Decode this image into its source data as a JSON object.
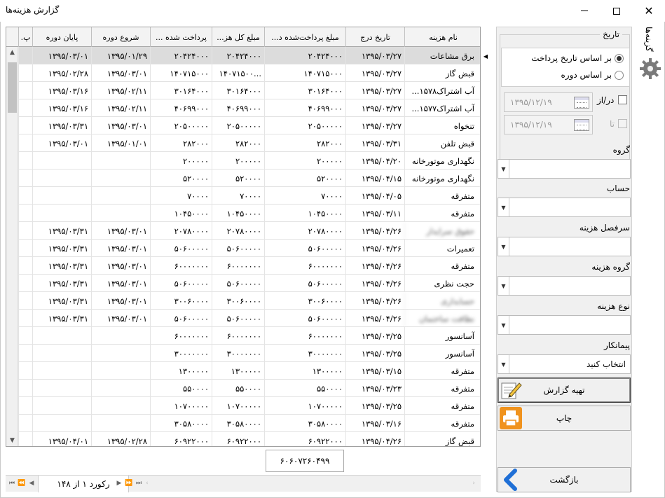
{
  "window": {
    "title": "گزارش هزینه‌ها",
    "min_label": "—",
    "close_label": "✕"
  },
  "grid": {
    "columns": [
      "پ.",
      "پایان دوره",
      "شروع دوره",
      "پرداخت شده ...",
      "مبلغ کل هز...",
      "مبلغ پرداخت‌شده د...",
      "تاریخ درج",
      "نام هزینه"
    ],
    "rows": [
      {
        "end": "۱۳۹۵/۰۳/۰۱",
        "start": "۱۳۹۵/۰۱/۲۹",
        "paid": "۲۰۴۲۴۰۰۰",
        "total": "۲۰۴۲۴۰۰۰",
        "paid_d": "۲۰۴۲۴۰۰۰",
        "date": "۱۳۹۵/۰۳/۲۷",
        "name": "برق مشاعات"
      },
      {
        "end": "۱۳۹۵/۰۲/۲۸",
        "start": "۱۳۹۵/۰۳/۰۱",
        "paid": "۱۴۰۷۱۵۰۰۰",
        "total": "...۱۴۰۷۱۵۰۰",
        "paid_d": "۱۴۰۷۱۵۰۰۰",
        "date": "۱۳۹۵/۰۳/۲۷",
        "name": "قبض گاز"
      },
      {
        "end": "۱۳۹۵/۰۳/۱۶",
        "start": "۱۳۹۵/۰۲/۱۱",
        "paid": "۳۰۱۶۴۰۰۰",
        "total": "۳۰۱۶۴۰۰۰",
        "paid_d": "۳۰۱۶۴۰۰۰",
        "date": "۱۳۹۵/۰۳/۲۷",
        "name": "آب اشتراک۱۵۷۸..."
      },
      {
        "end": "۱۳۹۵/۰۳/۱۶",
        "start": "۱۳۹۵/۰۲/۱۱",
        "paid": "۴۰۶۹۹۰۰۰",
        "total": "۴۰۶۹۹۰۰۰",
        "paid_d": "۴۰۶۹۹۰۰۰",
        "date": "۱۳۹۵/۰۳/۲۷",
        "name": "آب اشتراک۱۵۷۷..."
      },
      {
        "end": "۱۳۹۵/۰۳/۳۱",
        "start": "۱۳۹۵/۰۳/۰۱",
        "paid": "۲۰۵۰۰۰۰۰",
        "total": "۲۰۵۰۰۰۰۰",
        "paid_d": "۲۰۵۰۰۰۰۰",
        "date": "۱۳۹۵/۰۳/۲۷",
        "name": "تنخواه"
      },
      {
        "end": "۱۳۹۵/۰۳/۰۱",
        "start": "۱۳۹۵/۰۱/۰۱",
        "paid": "۲۸۲۰۰۰",
        "total": "۲۸۲۰۰۰",
        "paid_d": "۲۸۲۰۰۰",
        "date": "۱۳۹۵/۰۳/۳۱",
        "name": "قبض تلفن"
      },
      {
        "end": "",
        "start": "",
        "paid": "۲۰۰۰۰۰",
        "total": "۲۰۰۰۰۰",
        "paid_d": "۲۰۰۰۰۰",
        "date": "۱۳۹۵/۰۴/۲۰",
        "name": "نگهداری موتورخانه"
      },
      {
        "end": "",
        "start": "",
        "paid": "۵۲۰۰۰۰",
        "total": "۵۲۰۰۰۰",
        "paid_d": "۵۲۰۰۰۰",
        "date": "۱۳۹۵/۰۴/۱۵",
        "name": "نگهداری موتورخانه"
      },
      {
        "end": "",
        "start": "",
        "paid": "۷۰۰۰۰",
        "total": "۷۰۰۰۰",
        "paid_d": "۷۰۰۰۰",
        "date": "۱۳۹۵/۰۴/۰۵",
        "name": "متفرقه"
      },
      {
        "end": "",
        "start": "",
        "paid": "۱۰۴۵۰۰۰۰",
        "total": "۱۰۴۵۰۰۰۰",
        "paid_d": "۱۰۴۵۰۰۰۰",
        "date": "۱۳۹۵/۰۳/۱۱",
        "name": "متفرقه"
      },
      {
        "end": "۱۳۹۵/۰۳/۳۱",
        "start": "۱۳۹۵/۰۳/۰۱",
        "paid": "۲۰۷۸۰۰۰۰",
        "total": "۲۰۷۸۰۰۰۰",
        "paid_d": "۲۰۷۸۰۰۰۰",
        "date": "۱۳۹۵/۰۴/۲۶",
        "name": "حقوق سرایدار",
        "blur": true
      },
      {
        "end": "۱۳۹۵/۰۳/۳۱",
        "start": "۱۳۹۵/۰۳/۰۱",
        "paid": "۵۰۶۰۰۰۰۰",
        "total": "۵۰۶۰۰۰۰۰",
        "paid_d": "۵۰۶۰۰۰۰۰",
        "date": "۱۳۹۵/۰۴/۲۶",
        "name": "تعمیرات"
      },
      {
        "end": "۱۳۹۵/۰۳/۳۱",
        "start": "۱۳۹۵/۰۳/۰۱",
        "paid": "۶۰۰۰۰۰۰۰",
        "total": "۶۰۰۰۰۰۰۰",
        "paid_d": "۶۰۰۰۰۰۰۰",
        "date": "۱۳۹۵/۰۴/۲۶",
        "name": "متفرقه"
      },
      {
        "end": "۱۳۹۵/۰۳/۳۱",
        "start": "۱۳۹۵/۰۳/۰۱",
        "paid": "۵۰۶۰۰۰۰۰",
        "total": "۵۰۶۰۰۰۰۰",
        "paid_d": "۵۰۶۰۰۰۰۰",
        "date": "۱۳۹۵/۰۴/۲۶",
        "name": "حجت نظری"
      },
      {
        "end": "۱۳۹۵/۰۳/۳۱",
        "start": "۱۳۹۵/۰۳/۰۱",
        "paid": "۳۰۰۶۰۰۰۰",
        "total": "۳۰۰۶۰۰۰۰",
        "paid_d": "۳۰۰۶۰۰۰۰",
        "date": "۱۳۹۵/۰۴/۲۶",
        "name": "حسابداری",
        "blur": true
      },
      {
        "end": "۱۳۹۵/۰۳/۳۱",
        "start": "۱۳۹۵/۰۳/۰۱",
        "paid": "۵۰۶۰۰۰۰۰",
        "total": "۵۰۶۰۰۰۰۰",
        "paid_d": "۵۰۶۰۰۰۰۰",
        "date": "۱۳۹۵/۰۴/۲۶",
        "name": "نظافت ساختمان",
        "blur": true
      },
      {
        "end": "",
        "start": "",
        "paid": "۶۰۰۰۰۰۰۰",
        "total": "۶۰۰۰۰۰۰۰",
        "paid_d": "۶۰۰۰۰۰۰۰",
        "date": "۱۳۹۵/۰۳/۲۵",
        "name": "آسانسور"
      },
      {
        "end": "",
        "start": "",
        "paid": "۳۰۰۰۰۰۰۰",
        "total": "۳۰۰۰۰۰۰۰",
        "paid_d": "۳۰۰۰۰۰۰۰",
        "date": "۱۳۹۵/۰۳/۲۵",
        "name": "آسانسور"
      },
      {
        "end": "",
        "start": "",
        "paid": "۱۳۰۰۰۰۰",
        "total": "۱۳۰۰۰۰۰",
        "paid_d": "۱۳۰۰۰۰۰",
        "date": "۱۳۹۵/۰۳/۱۵",
        "name": "متفرقه"
      },
      {
        "end": "",
        "start": "",
        "paid": "۵۵۰۰۰۰",
        "total": "۵۵۰۰۰۰",
        "paid_d": "۵۵۰۰۰۰",
        "date": "۱۳۹۵/۰۳/۲۳",
        "name": "متفرقه"
      },
      {
        "end": "",
        "start": "",
        "paid": "۱۰۷۰۰۰۰۰",
        "total": "۱۰۷۰۰۰۰۰",
        "paid_d": "۱۰۷۰۰۰۰۰",
        "date": "۱۳۹۵/۰۳/۲۵",
        "name": "متفرقه"
      },
      {
        "end": "",
        "start": "",
        "paid": "۳۰۵۸۰۰۰۰",
        "total": "۳۰۵۸۰۰۰۰",
        "paid_d": "۳۰۵۸۰۰۰۰",
        "date": "۱۳۹۵/۰۳/۱۶",
        "name": "متفرقه"
      },
      {
        "end": "۱۳۹۵/۰۴/۰۱",
        "start": "۱۳۹۵/۰۲/۲۸",
        "paid": "۶۰۹۲۲۰۰۰",
        "total": "۶۰۹۲۲۰۰۰",
        "paid_d": "۶۰۹۲۲۰۰۰",
        "date": "۱۳۹۵/۰۴/۲۶",
        "name": "قبض گاز"
      }
    ],
    "total": "۶۰۶۰۷۲۶۰۴۹۹",
    "record_label": "رکورد ۱ از ۱۴۸"
  },
  "filters": {
    "date_legend": "تاریخ",
    "radio_payment": "بر اساس تاریخ پرداخت",
    "radio_period": "بر اساس دوره",
    "from_label": "در/از",
    "to_label": "تا",
    "from_date": "۱۳۹۵/۱۲/۱۹",
    "to_date": "۱۳۹۵/۱۲/۱۹",
    "group_label": "گروه",
    "account_label": "حساب",
    "cost_heading_label": "سرفصل هزینه",
    "cost_group_label": "گروه هزینه",
    "cost_type_label": "نوع هزینه",
    "contractor_label": "پیمانکار",
    "contractor_value": "انتخاب کنید",
    "prepare_button": "تهیه گزارش",
    "print_button": "چاپ",
    "back_button": "بازگشت"
  },
  "sidetab": {
    "label": "گزینه‌ها"
  },
  "colors": {
    "accent_orange": "#f0931e",
    "back_blue": "#1f6fd6",
    "selected_row": "#dcdcdc"
  }
}
